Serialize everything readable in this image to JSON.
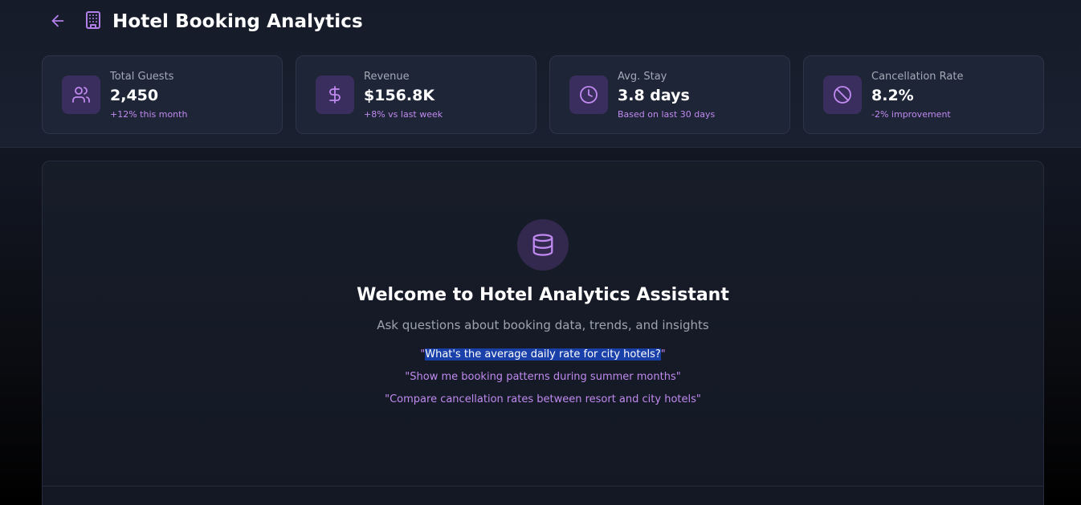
{
  "header": {
    "title": "Hotel Booking Analytics",
    "back_icon": "arrow-left-icon",
    "title_icon": "building-icon"
  },
  "stats": [
    {
      "label": "Total Guests",
      "value": "2,450",
      "sub": "+12% this month",
      "icon": "users-icon"
    },
    {
      "label": "Revenue",
      "value": "$156.8K",
      "sub": "+8% vs last week",
      "icon": "dollar-icon"
    },
    {
      "label": "Avg. Stay",
      "value": "3.8 days",
      "sub": "Based on last 30 days",
      "icon": "clock-icon"
    },
    {
      "label": "Cancellation Rate",
      "value": "8.2%",
      "sub": "-2% improvement",
      "icon": "ban-icon"
    }
  ],
  "welcome": {
    "icon": "database-icon",
    "title": "Welcome to Hotel Analytics Assistant",
    "subtitle": "Ask questions about booking data, trends, and insights",
    "suggestions": [
      "What's the average daily rate for city hotels?",
      "Show me booking patterns during summer months",
      "Compare cancellation rates between resort and city hotels"
    ]
  },
  "colors": {
    "accent": "#c08af0",
    "icon_bg": "#3a2e5e",
    "card_bg": "#1e2536",
    "selection": "#1840a8"
  }
}
